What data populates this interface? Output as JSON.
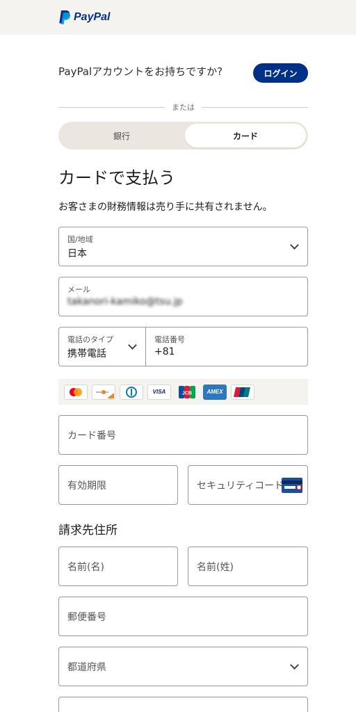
{
  "header": {
    "brand": "PayPal"
  },
  "account_prompt": {
    "text": "PayPalアカウントをお持ちですか?",
    "login_label": "ログイン"
  },
  "divider_text": "または",
  "payment_toggle": {
    "bank_label": "銀行",
    "card_label": "カード",
    "selected": "カード"
  },
  "page_title": "カードで支払う",
  "privacy_note": "お客さまの財務情報は売り手に共有されません。",
  "form": {
    "country": {
      "label": "国/地域",
      "value": "日本"
    },
    "email": {
      "label": "メール",
      "value": "takanori-kamiko@tsu.jp"
    },
    "phone_type": {
      "label": "電話のタイプ",
      "value": "携帯電話"
    },
    "phone_number": {
      "label": "電話番号",
      "value": "+81"
    },
    "card_number": {
      "placeholder": "カード番号"
    },
    "expiry": {
      "placeholder": "有効期限"
    },
    "security_code": {
      "placeholder": "セキュリティコード"
    }
  },
  "card_brands": [
    {
      "name": "mastercard-icon"
    },
    {
      "name": "discover-icon"
    },
    {
      "name": "diners-icon"
    },
    {
      "name": "visa-icon",
      "label": "VISA"
    },
    {
      "name": "jcb-icon",
      "label": "JCB"
    },
    {
      "name": "amex-icon",
      "label": "AMEX"
    },
    {
      "name": "unionpay-icon"
    }
  ],
  "billing": {
    "title": "請求先住所",
    "first_name": "名前(名)",
    "last_name": "名前(姓)",
    "postal_code": "郵便番号",
    "prefecture": "都道府県"
  },
  "colors": {
    "brand": "#003087",
    "brand_light": "#009cde",
    "border": "#999999"
  }
}
